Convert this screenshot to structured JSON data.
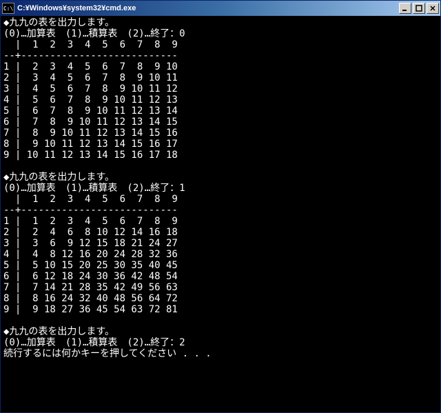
{
  "window": {
    "icon_label": "C:\\",
    "title": "C:¥Windows¥system32¥cmd.exe"
  },
  "prompts": {
    "title_line": "◆九九の表を出力します。",
    "menu_prefix": "(0)…加算表　(1)…積算表　(2)…終了：",
    "continue_line": "続行するには何かキーを押してください . . ."
  },
  "runs": [
    {
      "input": "0",
      "mode": "addition"
    },
    {
      "input": "1",
      "mode": "multiplication"
    },
    {
      "input": "2",
      "mode": "exit"
    }
  ],
  "table_header_cols": [
    1,
    2,
    3,
    4,
    5,
    6,
    7,
    8,
    9
  ],
  "chart_data": [
    {
      "type": "table",
      "title": "加算表 (Addition table, row + col)",
      "rows": [
        1,
        2,
        3,
        4,
        5,
        6,
        7,
        8,
        9
      ],
      "cols": [
        1,
        2,
        3,
        4,
        5,
        6,
        7,
        8,
        9
      ],
      "values": [
        [
          2,
          3,
          4,
          5,
          6,
          7,
          8,
          9,
          10
        ],
        [
          3,
          4,
          5,
          6,
          7,
          8,
          9,
          10,
          11
        ],
        [
          4,
          5,
          6,
          7,
          8,
          9,
          10,
          11,
          12
        ],
        [
          5,
          6,
          7,
          8,
          9,
          10,
          11,
          12,
          13
        ],
        [
          6,
          7,
          8,
          9,
          10,
          11,
          12,
          13,
          14
        ],
        [
          7,
          8,
          9,
          10,
          11,
          12,
          13,
          14,
          15
        ],
        [
          8,
          9,
          10,
          11,
          12,
          13,
          14,
          15,
          16
        ],
        [
          9,
          10,
          11,
          12,
          13,
          14,
          15,
          16,
          17
        ],
        [
          10,
          11,
          12,
          13,
          14,
          15,
          16,
          17,
          18
        ]
      ]
    },
    {
      "type": "table",
      "title": "積算表 (Multiplication table, row × col)",
      "rows": [
        1,
        2,
        3,
        4,
        5,
        6,
        7,
        8,
        9
      ],
      "cols": [
        1,
        2,
        3,
        4,
        5,
        6,
        7,
        8,
        9
      ],
      "values": [
        [
          1,
          2,
          3,
          4,
          5,
          6,
          7,
          8,
          9
        ],
        [
          2,
          4,
          6,
          8,
          10,
          12,
          14,
          16,
          18
        ],
        [
          3,
          6,
          9,
          12,
          15,
          18,
          21,
          24,
          27
        ],
        [
          4,
          8,
          12,
          16,
          20,
          24,
          28,
          32,
          36
        ],
        [
          5,
          10,
          15,
          20,
          25,
          30,
          35,
          40,
          45
        ],
        [
          6,
          12,
          18,
          24,
          30,
          36,
          42,
          48,
          54
        ],
        [
          7,
          14,
          21,
          28,
          35,
          42,
          49,
          56,
          63
        ],
        [
          8,
          16,
          24,
          32,
          40,
          48,
          56,
          64,
          72
        ],
        [
          9,
          18,
          27,
          36,
          45,
          54,
          63,
          72,
          81
        ]
      ]
    }
  ]
}
